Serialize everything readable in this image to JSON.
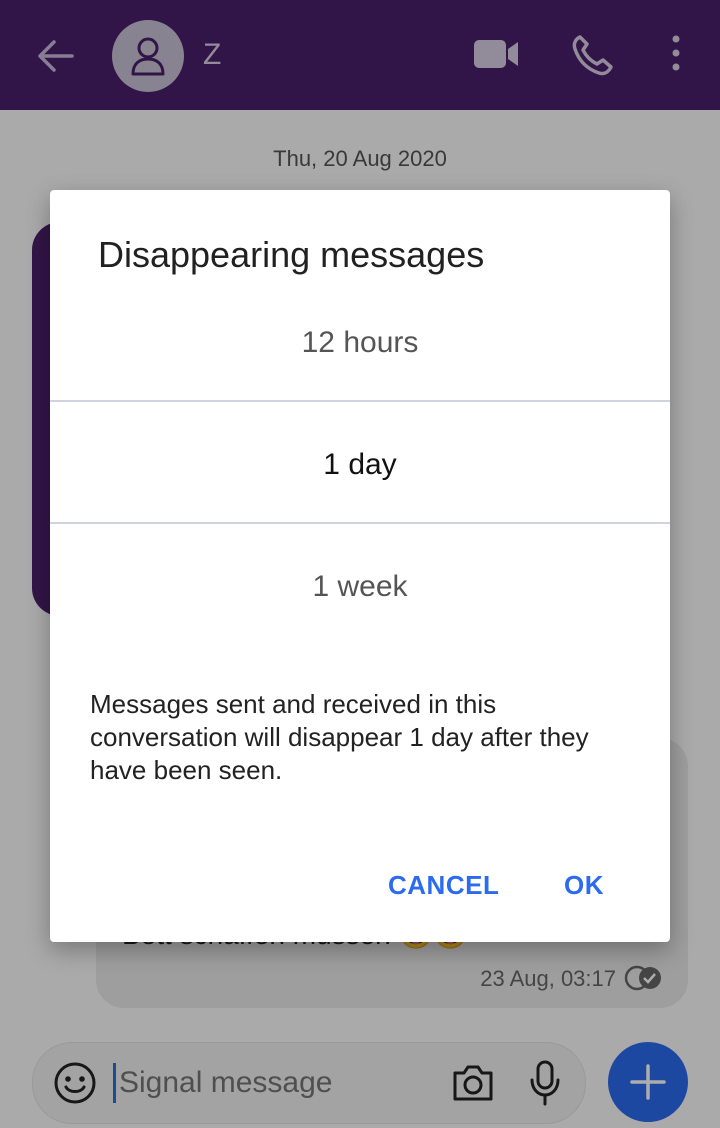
{
  "header": {
    "contact_name": "Z",
    "icons": [
      "back-arrow-icon",
      "avatar-person-icon",
      "video-call-icon",
      "phone-icon",
      "more-vert-icon"
    ]
  },
  "conversation": {
    "date_header": "Thu, 20 Aug 2020",
    "incoming_message": {
      "text": "Bett schaffen müssen 😅😅",
      "timestamp": "23 Aug, 03:17"
    }
  },
  "composer": {
    "placeholder": "Signal message",
    "icons": [
      "emoji-icon",
      "camera-icon",
      "mic-icon",
      "add-icon"
    ]
  },
  "dialog": {
    "title": "Disappearing messages",
    "picker": {
      "above": "12 hours",
      "selected": "1 day",
      "below": "1 week"
    },
    "description": "Messages sent and received in this conversation will disappear 1 day after they have been seen.",
    "cancel_label": "CANCEL",
    "ok_label": "OK"
  },
  "colors": {
    "appbar": "#4a1f6b",
    "accent": "#2c6bed",
    "scrim": "rgba(0,0,0,0.32)"
  }
}
